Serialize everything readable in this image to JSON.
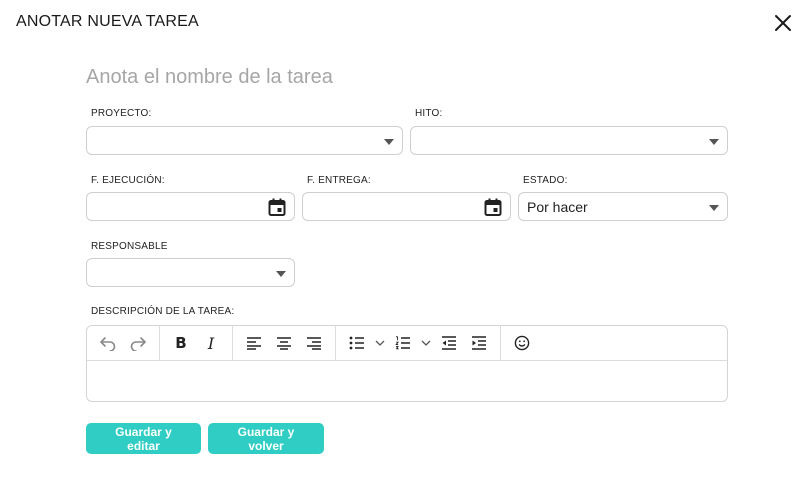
{
  "modal": {
    "title": "ANOTAR NUEVA TAREA"
  },
  "task": {
    "name_placeholder": "Anota el nombre de la tarea",
    "name_value": ""
  },
  "fields": {
    "project": {
      "label": "PROYECTO:",
      "value": ""
    },
    "milestone": {
      "label": "HITO:",
      "value": ""
    },
    "execution_date": {
      "label": "F. EJECUCIÓN:",
      "value": ""
    },
    "delivery_date": {
      "label": "F. ENTREGA:",
      "value": ""
    },
    "status": {
      "label": "ESTADO:",
      "value": "Por hacer"
    },
    "responsible": {
      "label": "RESPONSABLE",
      "value": ""
    }
  },
  "description": {
    "label": "DESCRIPCIÓN DE LA TAREA:",
    "value": ""
  },
  "toolbar": {
    "icons": [
      "undo-icon",
      "redo-icon",
      "bold-icon",
      "italic-icon",
      "align-left-icon",
      "align-center-icon",
      "align-right-icon",
      "bullet-list-icon",
      "numbered-list-icon",
      "outdent-icon",
      "indent-icon",
      "emoji-icon"
    ],
    "bold_glyph": "B",
    "italic_glyph": "I"
  },
  "actions": {
    "save_edit": "Guardar y editar",
    "save_back": "Guardar y volver"
  },
  "colors": {
    "accent": "#2fcdc4",
    "placeholder": "#a6a6a6",
    "border": "#cfcfcf"
  }
}
